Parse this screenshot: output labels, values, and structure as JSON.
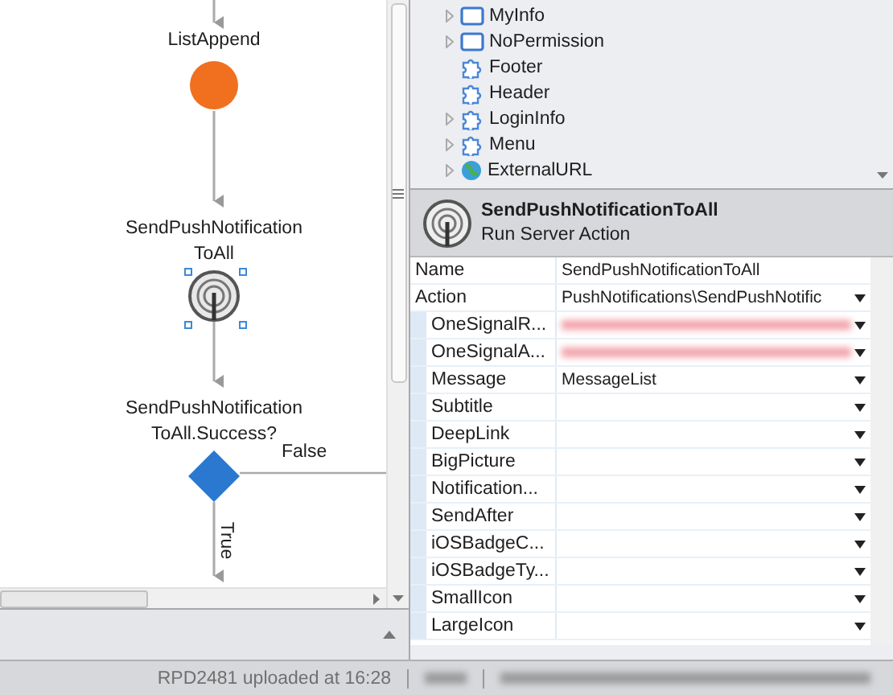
{
  "flow": {
    "nodes": [
      {
        "kind": "list-append",
        "lines": [
          "ListAppend"
        ],
        "selected": false
      },
      {
        "kind": "server-action",
        "lines": [
          "SendPushNotification",
          "ToAll"
        ],
        "selected": true
      },
      {
        "kind": "if",
        "lines": [
          "SendPushNotification",
          "ToAll.Success?"
        ],
        "selected": false
      }
    ],
    "branches": [
      {
        "kind": "false",
        "label": "False"
      },
      {
        "kind": "true",
        "label": "True"
      }
    ]
  },
  "tree": {
    "items": [
      {
        "kind": "screen",
        "label": "MyInfo",
        "expandable": true
      },
      {
        "kind": "screen",
        "label": "NoPermission",
        "expandable": true
      },
      {
        "kind": "block",
        "label": "Footer",
        "expandable": false
      },
      {
        "kind": "block",
        "label": "Header",
        "expandable": false
      },
      {
        "kind": "block",
        "label": "LoginInfo",
        "expandable": true
      },
      {
        "kind": "block",
        "label": "Menu",
        "expandable": true
      },
      {
        "kind": "link",
        "label": "ExternalURL",
        "expandable": true
      }
    ]
  },
  "properties": {
    "title": "SendPushNotificationToAll",
    "subtitle": "Run Server Action",
    "rows": [
      {
        "name": "Name",
        "value": "SendPushNotificationToAll",
        "indented": false,
        "dropdown": false,
        "blurred": false
      },
      {
        "name": "Action",
        "value": "PushNotifications\\SendPushNotific",
        "indented": false,
        "dropdown": true,
        "blurred": false
      },
      {
        "name": "OneSignalR...",
        "indented": true,
        "dropdown": true,
        "blurred": true
      },
      {
        "name": "OneSignalA...",
        "indented": true,
        "dropdown": true,
        "blurred": true
      },
      {
        "name": "Message",
        "value": "MessageList",
        "indented": true,
        "dropdown": true,
        "blurred": false
      },
      {
        "name": "Subtitle",
        "indented": true,
        "dropdown": true,
        "blurred": false
      },
      {
        "name": "DeepLink",
        "indented": true,
        "dropdown": true,
        "blurred": false
      },
      {
        "name": "BigPicture",
        "indented": true,
        "dropdown": true,
        "blurred": false
      },
      {
        "name": "Notification...",
        "indented": true,
        "dropdown": true,
        "blurred": false
      },
      {
        "name": "SendAfter",
        "indented": true,
        "dropdown": true,
        "blurred": false
      },
      {
        "name": "iOSBadgeC...",
        "indented": true,
        "dropdown": true,
        "blurred": false
      },
      {
        "name": "iOSBadgeTy...",
        "indented": true,
        "dropdown": true,
        "blurred": false
      },
      {
        "name": "SmallIcon",
        "indented": true,
        "dropdown": true,
        "blurred": false
      },
      {
        "name": "LargeIcon",
        "indented": true,
        "dropdown": true,
        "blurred": false
      }
    ]
  },
  "status_bar": {
    "message": "RPD2481 uploaded at 16:28"
  }
}
